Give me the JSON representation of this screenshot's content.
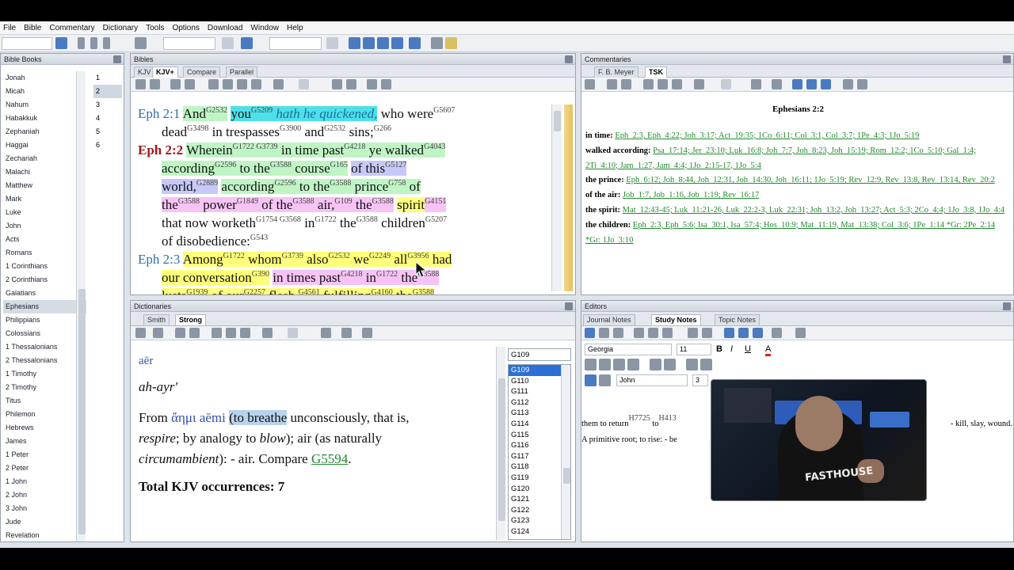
{
  "menu": [
    "File",
    "Bible",
    "Commentary",
    "Dictionary",
    "Tools",
    "Options",
    "Download",
    "Window",
    "Help"
  ],
  "panels": {
    "books": "Bible Books",
    "bibles": "Bibles",
    "commentaries": "Commentaries",
    "dictionaries": "Dictionaries",
    "editors": "Editors"
  },
  "books": [
    "Jonah",
    "Micah",
    "Nahum",
    "Habakkuk",
    "Zephaniah",
    "Haggai",
    "Zechariah",
    "Malachi",
    "Matthew",
    "Mark",
    "Luke",
    "John",
    "Acts",
    "Romans",
    "1 Corinthians",
    "2 Corinthians",
    "Galatians",
    "Ephesians",
    "Philippians",
    "Colossians",
    "1 Thessalonians",
    "2 Thessalonians",
    "1 Timothy",
    "2 Timothy",
    "Titus",
    "Philemon",
    "Hebrews",
    "James",
    "1 Peter",
    "2 Peter",
    "1 John",
    "2 John",
    "3 John",
    "Jude",
    "Revelation"
  ],
  "selected_book": "Ephesians",
  "chapters": [
    "1",
    "2",
    "3",
    "4",
    "5",
    "6"
  ],
  "selected_chapter": "2",
  "bible_tabs": [
    "KJV",
    "KJV+",
    "Compare",
    "Parallel"
  ],
  "active_bible_tab": "KJV+",
  "verse_refs": {
    "v1": "Eph 2:1",
    "v2": "Eph 2:2",
    "v3": "Eph 2:3"
  },
  "commentary_tabs": [
    "F. B. Meyer",
    "TSK"
  ],
  "active_commentary_tab": "TSK",
  "commentary_title": "Ephesians 2:2",
  "commentary_entries": [
    {
      "key": "in time:",
      "refs": "Eph_2:3, Eph_4:22; Joh_3:17; Act_19:35; 1Co_6:11; Col_3:1, Col_3:7; 1Pe_4:3; 1Jo_5:19"
    },
    {
      "key": "walked according:",
      "refs": "Psa_17:14; Jer_23:10; Luk_16:8; Joh_7:7, Joh_8:23, Joh_15:19; Rom_12:2; 1Co_5:10; Gal_1:4; 2Ti_4:10; Jam_1:27, Jam_4:4; 1Jo_2:15-17, 1Jo_5:4"
    },
    {
      "key": "the prince:",
      "refs": "Eph_6:12; Joh_8:44, Joh_12:31, Joh_14:30, Joh_16:11; 1Jo_5:19; Rev_12:9, Rev_13:8, Rev_13:14, Rev_20:2"
    },
    {
      "key": "of the air:",
      "refs": "Job_1:7, Job_1:16, Job_1:19; Rev_16:17"
    },
    {
      "key": "the spirit:",
      "refs": "Mat_12:43-45; Luk_11:21-26, Luk_22:2-3, Luk_22:31; Joh_13:2, Joh_13:27; Act_5:3; 2Co_4:4; 1Jo_3:8, 1Jo_4:4"
    },
    {
      "key": "the children:",
      "refs": "Eph_2:3, Eph_5:6; Isa_30:1, Isa_57:4; Hos_10:9; Mat_11:19, Mat_13:38; Col_3:6; 1Pe_1:14 *Gr: 2Pe_2:14 *Gr: 1Jo_3:10"
    }
  ],
  "dict_tabs": [
    "Smith",
    "Strong"
  ],
  "active_dict_tab": "Strong",
  "dict": {
    "translit": "aēr",
    "pron": "ah-ayr'",
    "from_label": "From",
    "greek": "ἄημι aēmi",
    "def_a": "(to breathe",
    "def_b": "unconsciously, that is,",
    "def_c": "respire",
    "def_d": "; by analogy to",
    "def_e": "blow",
    "def_f": "); air (as naturally",
    "def_g": "circumambient",
    "def_h": "): - air. Compare",
    "link": "G5594",
    "total": "Total KJV occurrences: 7"
  },
  "strongs_search": "G109",
  "strongs_list": [
    "G109",
    "G110",
    "G111",
    "G112",
    "G113",
    "G114",
    "G115",
    "G116",
    "G117",
    "G118",
    "G119",
    "G120",
    "G121",
    "G122",
    "G123",
    "G124"
  ],
  "editor_tabs": [
    "Journal Notes",
    "Study Notes",
    "Topic Notes"
  ],
  "active_editor_tab": "Study Notes",
  "editor": {
    "font": "Georgia",
    "size": "11",
    "style": "John",
    "num": "3",
    "line1": "them to return",
    "line1_s": "H7725",
    "line1_b": "to",
    "line1_s2": "H413",
    "line1_right": "- kill, slay, wound.",
    "line2": "A primitive root; to rise: - be"
  },
  "video": {
    "shirt": "FASTHOUSE"
  },
  "colors": {
    "link": "#1f8a2a",
    "verse_ref": "#2f6fa8",
    "current_ref": "#a01818",
    "green": "#bff5c4",
    "cyan": "#4ee0e8",
    "pink": "#f6c3f4",
    "yellow": "#ffff7a",
    "lavender": "#c8c8f8"
  }
}
